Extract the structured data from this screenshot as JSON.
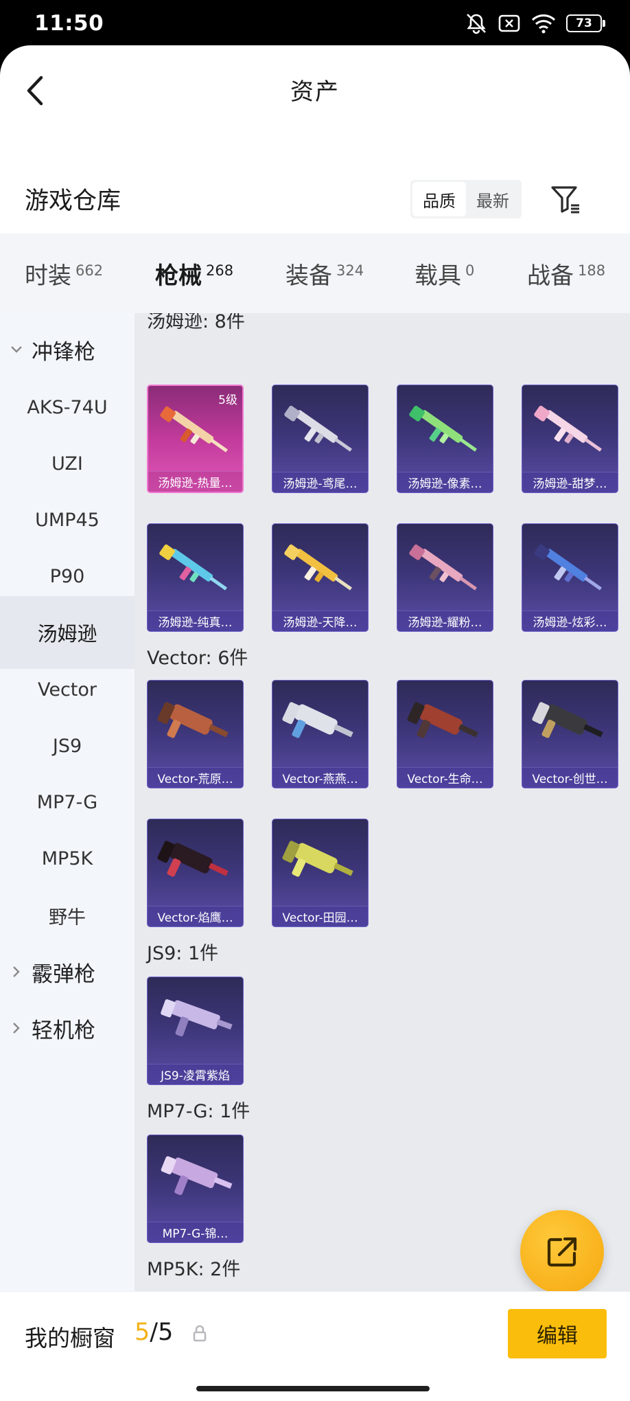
{
  "status_bar": {
    "time": "11:50",
    "battery": "73"
  },
  "header": {
    "title": "资产"
  },
  "warehouse": {
    "title": "游戏仓库",
    "sort_options": [
      "品质",
      "最新"
    ],
    "active_sort": "品质"
  },
  "tabs": [
    {
      "label": "时装",
      "count": "662"
    },
    {
      "label": "枪械",
      "count": "268"
    },
    {
      "label": "装备",
      "count": "324"
    },
    {
      "label": "载具",
      "count": "0"
    },
    {
      "label": "战备",
      "count": "188"
    }
  ],
  "sidebar": {
    "categories": [
      "冲锋枪",
      "霰弹枪",
      "轻机枪"
    ],
    "weapons": [
      "AKS-74U",
      "UZI",
      "UMP45",
      "P90",
      "汤姆逊",
      "Vector",
      "JS9",
      "MP7-G",
      "MP5K",
      "野牛"
    ],
    "active": "汤姆逊"
  },
  "groups": [
    {
      "label": "汤姆逊: 8件",
      "items": [
        "汤姆逊-热量…",
        "汤姆逊-鸢尾…",
        "汤姆逊-像素…",
        "汤姆逊-甜梦…",
        "汤姆逊-纯真…",
        "汤姆逊-天降…",
        "汤姆逊-耀粉…",
        "汤姆逊-炫彩…"
      ],
      "first_level": "5级"
    },
    {
      "label": "Vector: 6件",
      "items": [
        "Vector-荒原…",
        "Vector-燕燕…",
        "Vector-生命…",
        "Vector-创世…",
        "Vector-焰鹰…",
        "Vector-田园…"
      ]
    },
    {
      "label": "JS9: 1件",
      "items": [
        "JS9-凌霄紫焰"
      ]
    },
    {
      "label": "MP7-G: 1件",
      "items": [
        "MP7-G-锦…"
      ]
    },
    {
      "label": "MP5K: 2件",
      "items": [
        "",
        ""
      ]
    }
  ],
  "bottom": {
    "label": "我的橱窗",
    "current": "5",
    "total": "/5",
    "edit": "编辑"
  },
  "colors": {
    "accent": "#fbbd0c",
    "card_purple": "#3c3577",
    "card_pink": "#c23a9b"
  }
}
